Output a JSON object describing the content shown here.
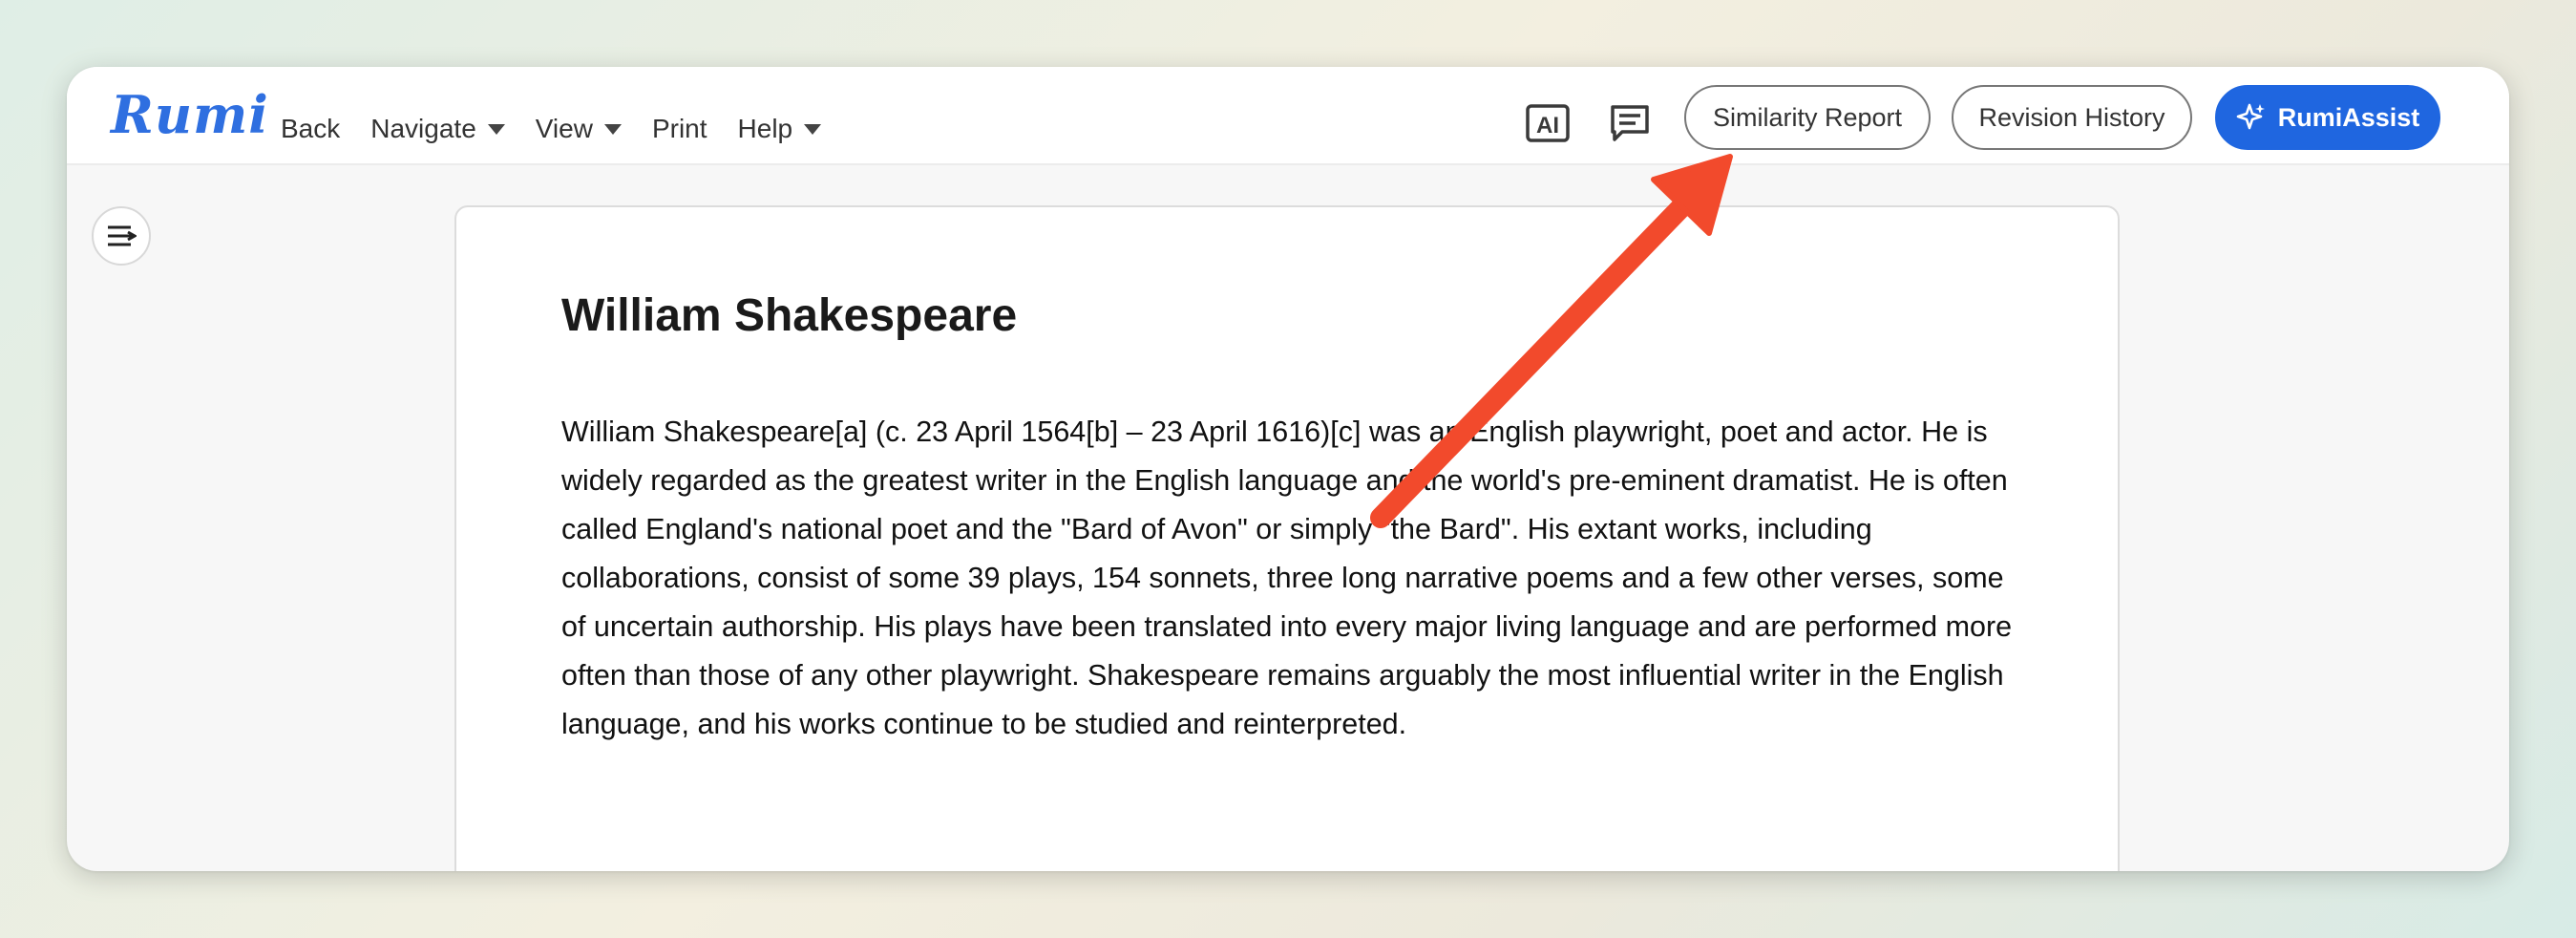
{
  "app": {
    "logo_text": "Rumi"
  },
  "menu": {
    "back": "Back",
    "navigate": "Navigate",
    "view": "View",
    "print": "Print",
    "help": "Help"
  },
  "toolbar": {
    "ai_icon_text": "AI",
    "similarity_report": "Similarity Report",
    "revision_history": "Revision History",
    "rumi_assist": "RumiAssist"
  },
  "document": {
    "title": "William Shakespeare",
    "body": "William Shakespeare[a] (c. 23 April 1564[b] – 23 April 1616)[c] was an English playwright, poet and actor. He is widely regarded as the greatest writer in the English language and the world's pre-eminent dramatist. He is often called England's national poet and the \"Bard of Avon\" or simply \"the Bard\". His extant works, including collaborations, consist of some 39 plays, 154 sonnets, three long narrative poems and a few other verses, some of uncertain authorship. His plays have been translated into every major living language and are performed more often than those of any other playwright. Shakespeare remains arguably the most influential writer in the English language, and his works continue to be studied and reinterpreted."
  },
  "colors": {
    "accent": "#1f66e0",
    "annotation_arrow": "#f24a2c"
  },
  "icons": [
    "ai-icon",
    "comment-icon",
    "sparkle-icon",
    "sidebar-toggle-icon",
    "annotation-arrow"
  ]
}
